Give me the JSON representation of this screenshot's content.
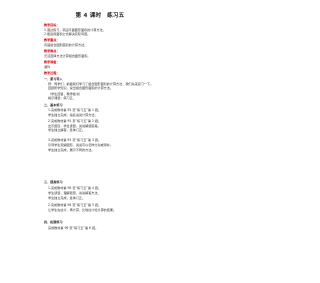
{
  "document": {
    "title": "第 4 课时　练习五",
    "goals_heading": "教学目标：",
    "goals": [
      "1.通过练习，巩固平面图形面积的计算方法。",
      "2.能运用面积公式解决实际问题。"
    ],
    "key_heading": "教学重点：",
    "key_text": "巩固组合图形面积的计算方法。",
    "difficulty_heading": "教学难点：",
    "difficulty_text": "灵活选择方法计算组合图形面积。",
    "prep_heading": "教学准备：",
    "prep_text": "课件",
    "process_heading": "教学过程：",
    "sections": [
      {
        "heading": "一、复习导入",
        "lines": [
          "师：同学们，前面我们学习了组合图形面积的计算方法，我们先来复习一下。",
          "回顾所学知识，说出组合图形面积的计算方法。",
          "（学生回答，教师板书）",
          "揭示课题：练习五。"
        ]
      },
      {
        "heading": "二、基本练习",
        "lines": [
          "1.完成教材第 95 页“练习五”第 1 题。",
          "学生独立完成，指名说说计算方法。",
          "2.完成教材第 95 页“练习五”第 2 题。",
          "出示题目，学生读题，说说解题思路。",
          "学生独立解答，集体订正。",
          "3.完成教材第 95 页“练习五”第 3 题。",
          "引导学生观察图形，说说可以怎样分割或添补。",
          "学生独立完成，展示不同的方法。"
        ]
      },
      {
        "heading": "三、提高练习",
        "lines": [
          "1.完成教材第 96 页“练习五”第 4 题。",
          "学生读题，理解题意，说说解答方法。",
          "学生独立完成，集体订正。",
          "2.完成教材第 96 页“练习五”第 5 题。",
          "让学生先估计，再计算，比较估计和计算的结果。"
        ]
      },
      {
        "heading": "四、拓展练习",
        "lines": [
          "完成教材第 96 页“练习五”第 6 题。"
        ]
      }
    ]
  }
}
